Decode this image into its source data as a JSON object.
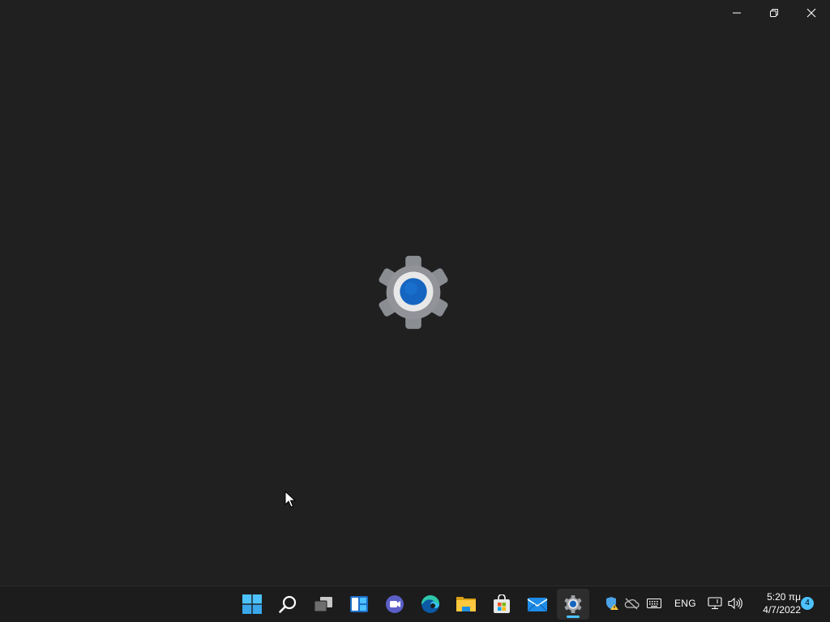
{
  "window": {
    "app_name": "Settings",
    "splash_icon": "settings-gear-icon",
    "caption_buttons": [
      {
        "name": "minimize",
        "icon": "minimize-icon"
      },
      {
        "name": "restore",
        "icon": "restore-icon"
      },
      {
        "name": "close",
        "icon": "close-icon"
      }
    ]
  },
  "taskbar": {
    "pinned": [
      {
        "name": "Start",
        "icon": "windows-start-icon"
      },
      {
        "name": "Search",
        "icon": "search-icon"
      },
      {
        "name": "Task View",
        "icon": "task-view-icon"
      },
      {
        "name": "Widgets",
        "icon": "widgets-icon"
      },
      {
        "name": "Chat",
        "icon": "teams-chat-icon"
      },
      {
        "name": "Microsoft Edge",
        "icon": "edge-icon"
      },
      {
        "name": "File Explorer",
        "icon": "file-explorer-icon"
      },
      {
        "name": "Microsoft Store",
        "icon": "store-icon"
      },
      {
        "name": "Mail",
        "icon": "mail-icon"
      },
      {
        "name": "Settings",
        "icon": "settings-icon",
        "active": true
      }
    ],
    "tray": {
      "icons": [
        "security-warning-icon",
        "onedrive-offline-icon",
        "touch-keyboard-icon"
      ],
      "language": "ENG",
      "system_icons": [
        "network-icon",
        "volume-icon"
      ],
      "time": "5:20 πμ",
      "date": "4/7/2022",
      "notification_count": "4"
    }
  },
  "colors": {
    "background": "#202020",
    "taskbar": "#1c1c1c",
    "accent": "#4cc2ff",
    "gear_gray": "#8a8d92",
    "gear_blue": "#1565c0"
  }
}
